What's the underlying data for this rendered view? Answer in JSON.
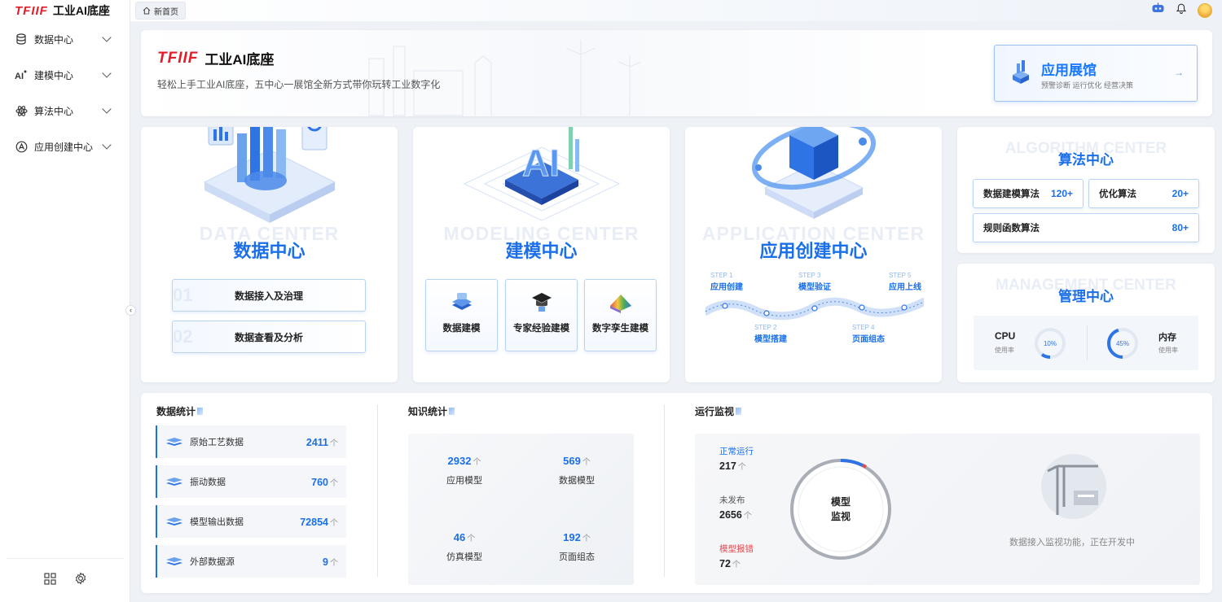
{
  "brand": {
    "logo": "TFIIF",
    "name": "工业AI底座"
  },
  "sidebar": {
    "items": [
      {
        "label": "数据中心",
        "icon": "database-icon"
      },
      {
        "label": "建模中心",
        "icon": "ai-model-icon"
      },
      {
        "label": "算法中心",
        "icon": "atom-icon"
      },
      {
        "label": "应用创建中心",
        "icon": "app-create-icon"
      }
    ],
    "footer_icons": [
      "grid-icon",
      "gear-icon"
    ],
    "collapse_glyph": "‹"
  },
  "topbar": {
    "tab_label": "新首页"
  },
  "hero": {
    "logo": "TFIIF",
    "title": "工业AI底座",
    "subtitle": "轻松上手工业AI底座，五中心一展馆全新方式带你玩转工业数字化",
    "showroom": {
      "title": "应用展馆",
      "subtitle": "预警诊断 运行优化 经营决策",
      "arrow": "→"
    }
  },
  "data_center": {
    "bg_text": "DATA CENTER",
    "title": "数据中心",
    "buttons": [
      {
        "num": "01",
        "label": "数据接入及治理"
      },
      {
        "num": "02",
        "label": "数据查看及分析"
      }
    ]
  },
  "modeling_center": {
    "bg_text": "MODELING CENTER",
    "title": "建模中心",
    "tiles": [
      "数据建模",
      "专家经验建模",
      "数字孪生建模"
    ]
  },
  "application_center": {
    "bg_text": "APPLICATION CENTER",
    "title": "应用创建中心",
    "steps": [
      {
        "step": "STEP 1",
        "label": "应用创建"
      },
      {
        "step": "STEP 2",
        "label": "模型搭建"
      },
      {
        "step": "STEP 3",
        "label": "模型验证"
      },
      {
        "step": "STEP 4",
        "label": "页面组态"
      },
      {
        "step": "STEP 5",
        "label": "应用上线"
      }
    ]
  },
  "algorithm_center": {
    "bg_text": "ALGORITHM CENTER",
    "title": "算法中心",
    "items": [
      {
        "label": "数据建模算法",
        "value": "120+"
      },
      {
        "label": "优化算法",
        "value": "20+"
      },
      {
        "label": "规则函数算法",
        "value": "80+"
      }
    ]
  },
  "management_center": {
    "bg_text": "MANAGEMENT CENTER",
    "title": "管理中心",
    "cpu": {
      "label": "CPU",
      "sub": "使用率",
      "value": "10%",
      "percent": 10
    },
    "memory": {
      "label": "内存",
      "sub": "使用率",
      "value": "45%",
      "percent": 45
    }
  },
  "data_stats": {
    "title": "数据统计",
    "unit": "个",
    "rows": [
      {
        "label": "原始工艺数据",
        "value": "2411"
      },
      {
        "label": "振动数据",
        "value": "760"
      },
      {
        "label": "模型输出数据",
        "value": "72854"
      },
      {
        "label": "外部数据源",
        "value": "9"
      }
    ]
  },
  "knowledge_stats": {
    "title": "知识统计",
    "unit": "个",
    "items": [
      {
        "label": "应用模型",
        "value": "2932"
      },
      {
        "label": "数据模型",
        "value": "569"
      },
      {
        "label": "仿真模型",
        "value": "46"
      },
      {
        "label": "页面组态",
        "value": "192"
      }
    ]
  },
  "monitor": {
    "title": "运行监视",
    "unit": "个",
    "items": [
      {
        "label": "正常运行",
        "value": "217"
      },
      {
        "label": "未发布",
        "value": "2656"
      },
      {
        "label": "模型报错",
        "value": "72"
      }
    ],
    "ring_center_line1": "模型",
    "ring_center_line2": "监视",
    "dev_note": "数据接入监视功能，正在开发中"
  },
  "colors": {
    "accent": "#1b6fe8",
    "brand_red": "#e11d2a",
    "error": "#e5484d"
  }
}
